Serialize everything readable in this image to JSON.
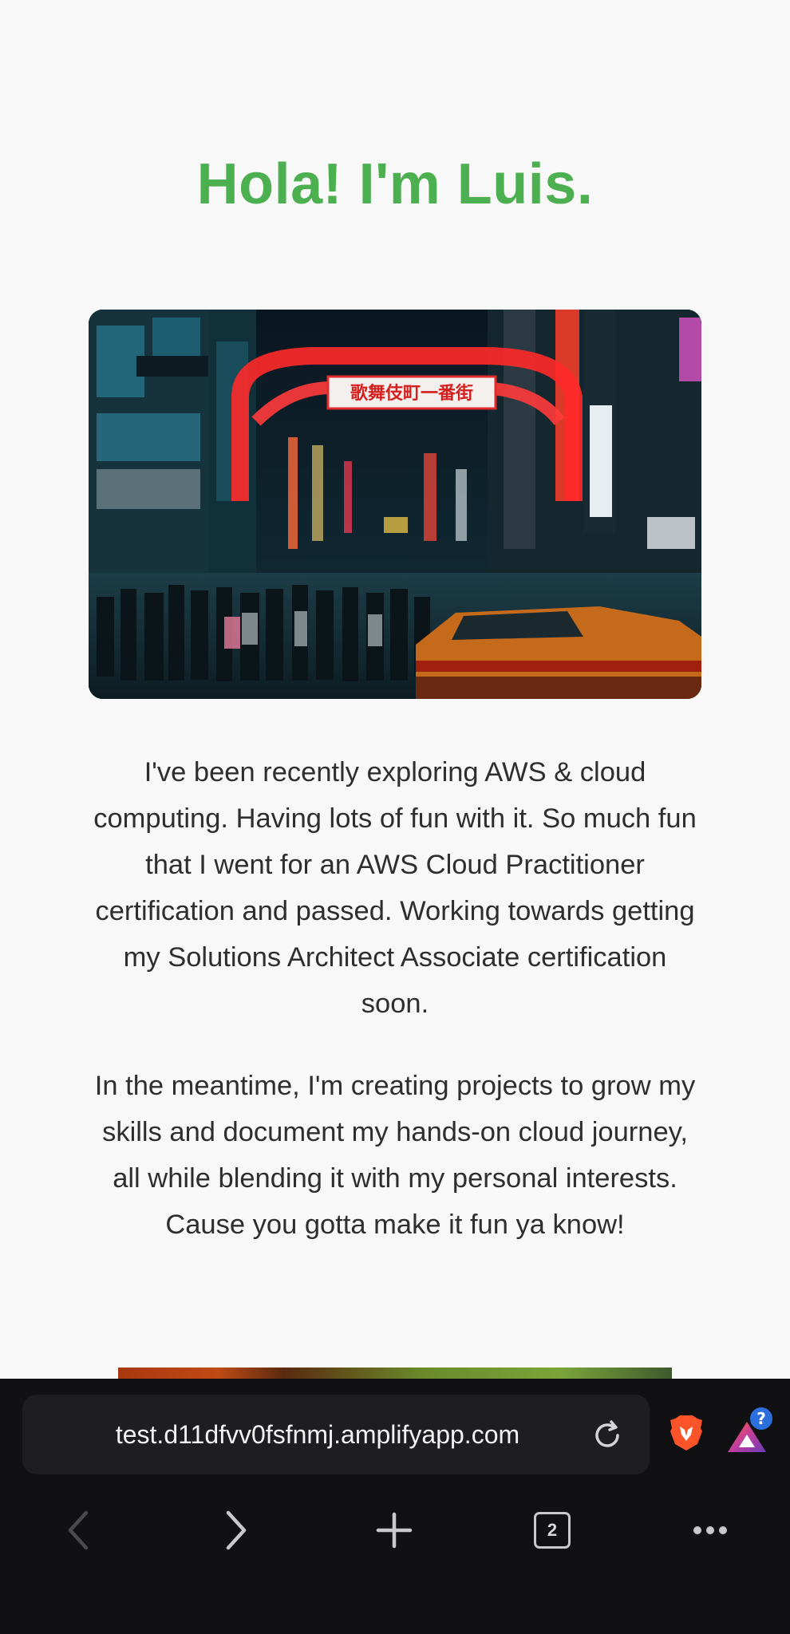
{
  "page": {
    "title": "Hola! I'm Luis.",
    "hero_image_alt": "",
    "paragraphs": [
      "I've been recently exploring AWS & cloud computing. Having lots of fun with it. So much fun that I went for an AWS Cloud Practitioner certification and passed. Working towards getting my Solutions Architect Associate certification soon.",
      "In the meantime, I'm creating projects to grow my skills and document my hands-on cloud journey, all while blending it with my personal interests. Cause you gotta make it fun ya know!"
    ],
    "hero_sign_text": "歌舞伎町一番街"
  },
  "browser": {
    "url": "test.d11dfvv0fsfnmj.amplifyapp.com",
    "tab_count": "2",
    "rewards_badge": "?",
    "icons": {
      "reload": "reload-icon",
      "brave": "brave-lion-icon",
      "rewards": "brave-rewards-icon",
      "back": "chevron-left-icon",
      "forward": "chevron-right-icon",
      "new_tab": "plus-icon",
      "tabs": "tabs-icon",
      "more": "more-dots-icon"
    },
    "colors": {
      "accent_green": "#4caf50",
      "bar_bg": "#111114",
      "brave_orange": "#fb542b"
    }
  }
}
